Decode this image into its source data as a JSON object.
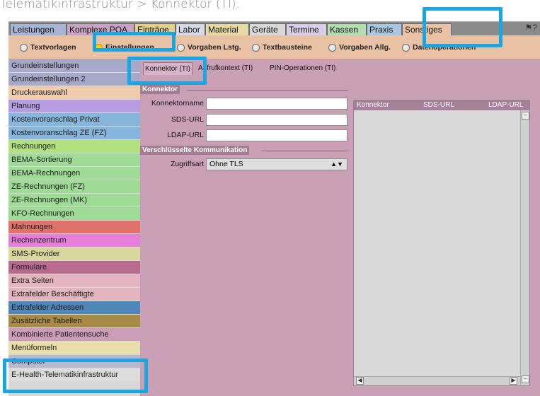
{
  "caption": "Telematikinfrastruktur > Konnektor (TI).",
  "main_tabs": [
    {
      "label": "Leistungen",
      "color": "#a8b4d4"
    },
    {
      "label": "Komplexe POA",
      "color": "#c9a3c0"
    },
    {
      "label": "Einträge",
      "color": "#e4cf8e"
    },
    {
      "label": "Labor",
      "color": "#d8d9e6"
    },
    {
      "label": "Material",
      "color": "#e6d9a4"
    },
    {
      "label": "Geräte",
      "color": "#d9d9d9"
    },
    {
      "label": "Termine",
      "color": "#d7cfe8"
    },
    {
      "label": "Kassen",
      "color": "#b3dcb2"
    },
    {
      "label": "Praxis",
      "color": "#a9c7de"
    },
    {
      "label": "Sonstiges",
      "color": "#e9c1a4"
    }
  ],
  "help_icon": "help-icon",
  "sub_tabs": [
    {
      "label": "Textvorlagen",
      "selected": false
    },
    {
      "label": "Einstellungen",
      "selected": true
    },
    {
      "label": "Vorgaben Lstg.",
      "selected": false
    },
    {
      "label": "Textbausteine",
      "selected": false
    },
    {
      "label": "Vorgaben Allg.",
      "selected": false
    },
    {
      "label": "Datenoperationen",
      "selected": false
    }
  ],
  "sidebar": {
    "items": [
      {
        "label": "Grundeinstellungen",
        "color": "#a6a9c8"
      },
      {
        "label": "Grundeinstellungen 2",
        "color": "#a6a9c8"
      },
      {
        "label": "Druckerauswahl",
        "color": "#f0ccae"
      },
      {
        "label": "Planung",
        "color": "#b89ce0"
      },
      {
        "label": "Kostenvoranschlag Privat",
        "color": "#87b6dc"
      },
      {
        "label": "Kostenvoranschlag ZE (FZ)",
        "color": "#87b6dc"
      },
      {
        "label": "Rechnungen",
        "color": "#b1e07f"
      },
      {
        "label": "BEMA-Sortierung",
        "color": "#9fdb96"
      },
      {
        "label": "BEMA-Rechnungen",
        "color": "#9fdb96"
      },
      {
        "label": "ZE-Rechnungen (FZ)",
        "color": "#9fdb96"
      },
      {
        "label": "ZE-Rechnungen (MK)",
        "color": "#9fdb96"
      },
      {
        "label": "KFO-Rechnungen",
        "color": "#9fdb96"
      },
      {
        "label": "Mahnungen",
        "color": "#e0726c"
      },
      {
        "label": "Rechenzentrum",
        "color": "#e57fda"
      },
      {
        "label": "SMS-Provider",
        "color": "#d8d89c"
      },
      {
        "label": "Formulare",
        "color": "#b76b8d"
      },
      {
        "label": "Extra Seiten",
        "color": "#e2b5c0"
      },
      {
        "label": "Extrafelder Beschäftigte",
        "color": "#e2b5c0"
      },
      {
        "label": "Extrafelder Adressen",
        "color": "#4f86b9"
      },
      {
        "label": "Zusätzliche Tabellen",
        "color": "#a88c45"
      },
      {
        "label": "Kombinierte Patientensuche",
        "color": "#cb9db8"
      },
      {
        "label": "Menüformeln",
        "color": "#e7dfa7"
      },
      {
        "label": "Computer",
        "color": "#b8b8d2"
      },
      {
        "label": "E-Health-Telematikinfrastruktur",
        "color": "#dcdcdc"
      }
    ]
  },
  "content": {
    "tabs": [
      "Konnektor (TI)",
      "Aufrufkontext (TI)",
      "PIN-Operationen (TI)"
    ],
    "section_connector": "Konnektor",
    "fields": [
      {
        "label": "Konnektorname",
        "value": ""
      },
      {
        "label": "SDS-URL",
        "value": ""
      },
      {
        "label": "LDAP-URL",
        "value": ""
      }
    ],
    "section_encryption": "Verschlüsselte Kommunikation",
    "access_label": "Zugriffsart",
    "access_value": "Ohne TLS",
    "table_columns": [
      "Konnektor",
      "SDS-URL",
      "LDAP-URL"
    ]
  },
  "highlight_color": "#1aa6e3"
}
